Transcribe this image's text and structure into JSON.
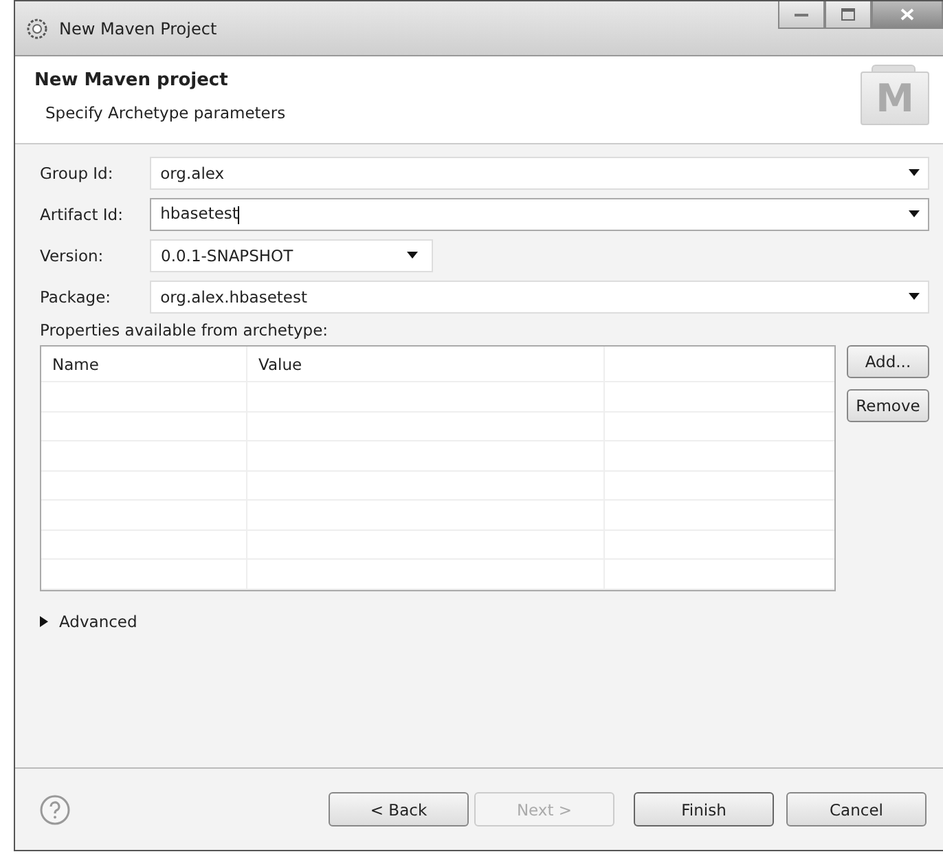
{
  "window": {
    "title": "New Maven Project"
  },
  "header": {
    "title": "New Maven project",
    "subtitle": "Specify Archetype parameters",
    "logo_letter": "M"
  },
  "fields": [
    {
      "label": "Group Id:",
      "value": "org.alex",
      "wide": true,
      "focused": false
    },
    {
      "label": "Artifact Id:",
      "value": "hbasetest",
      "wide": true,
      "focused": true
    },
    {
      "label": "Version:",
      "value": "0.0.1-SNAPSHOT",
      "wide": false,
      "focused": false
    },
    {
      "label": "Package:",
      "value": "org.alex.hbasetest",
      "wide": true,
      "focused": false
    }
  ],
  "properties": {
    "label": "Properties available from archetype:",
    "columns": [
      "Name",
      "Value"
    ],
    "buttons": [
      "Add...",
      "Remove"
    ]
  },
  "advanced": {
    "label": "Advanced",
    "expanded": false
  },
  "buttons": [
    {
      "label": "< Back",
      "disabled": false
    },
    {
      "label": "Next >",
      "disabled": true
    },
    {
      "label": "Finish",
      "disabled": false
    },
    {
      "label": "Cancel",
      "disabled": false
    }
  ]
}
